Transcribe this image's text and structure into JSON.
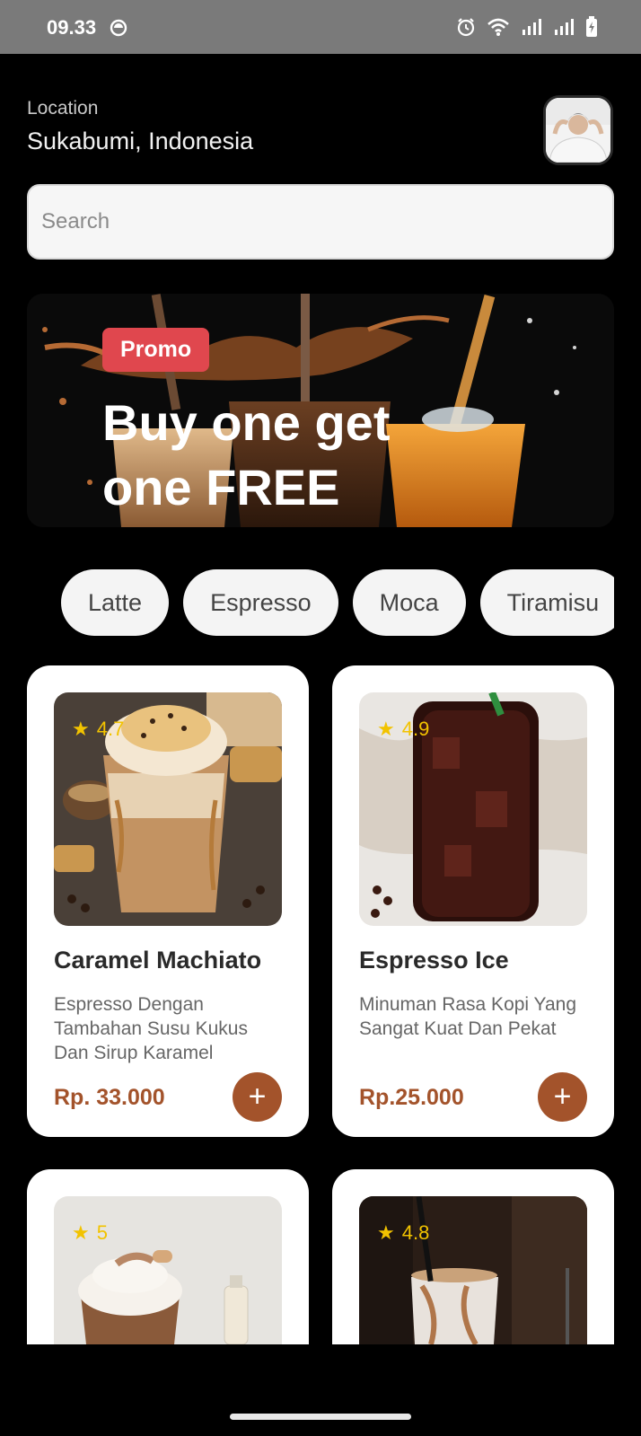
{
  "status_bar": {
    "time": "09.33",
    "icons": [
      "sync-icon",
      "alarm-icon",
      "wifi-icon",
      "signal-icon",
      "signal-icon",
      "battery-icon"
    ]
  },
  "header": {
    "location_label": "Location",
    "location_value": "Sukabumi, Indonesia"
  },
  "search": {
    "placeholder": "Search"
  },
  "promo": {
    "badge": "Promo",
    "title": "Buy one get one FREE"
  },
  "categories": [
    "Latte",
    "Espresso",
    "Moca",
    "Tiramisu"
  ],
  "products": [
    {
      "name": "Caramel Machiato",
      "description": "Espresso Dengan Tambahan Susu Kukus Dan Sirup Karamel",
      "price": "Rp. 33.000",
      "rating": "4.7"
    },
    {
      "name": "Espresso Ice",
      "description": "Minuman Rasa Kopi Yang Sangat Kuat Dan Pekat",
      "price": "Rp.25.000",
      "rating": "4.9"
    },
    {
      "name": "",
      "description": "",
      "price": "",
      "rating": "5"
    },
    {
      "name": "",
      "description": "",
      "price": "",
      "rating": "4.8"
    }
  ],
  "colors": {
    "accent": "#a3532b",
    "promo": "#e0474e",
    "rating": "#f2c300",
    "background": "#000000"
  },
  "add_icon": "plus-icon",
  "star_icon": "star-icon"
}
